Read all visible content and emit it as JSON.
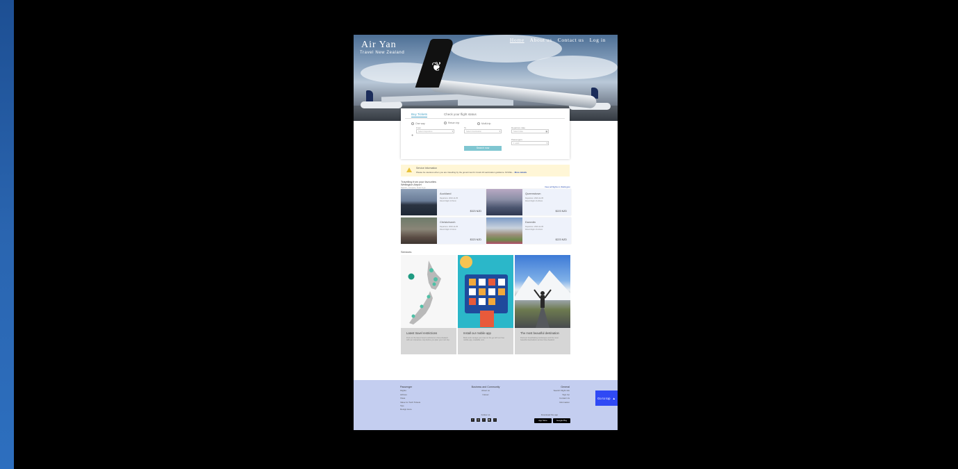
{
  "site": {
    "brand": "Air Yan",
    "tagline": "Travel New Zealand"
  },
  "nav": [
    "Home",
    "About us",
    "Contact us",
    "Log in"
  ],
  "booking": {
    "tabs": [
      "Buy Tickets",
      "Check your flight status"
    ],
    "trip_types": [
      "One way",
      "Return trip",
      "Multi-trip"
    ],
    "from_label": "From",
    "from_placeholder": "Select departure",
    "to_label": "To",
    "to_placeholder": "Select destination",
    "departure_label": "Departure date",
    "departure_placeholder": "Select date",
    "passengers_label": "Passengers",
    "passengers_value": "1 adult",
    "search_label": "Search now"
  },
  "announcement": {
    "title": "Service Information",
    "text": "Please be cautious when you are travelling by the government's Covid-19 vaccination guidance. NOVEL...",
    "link": "More details"
  },
  "destinations": {
    "heading": "Travelling from your favourites",
    "airport": "Wellington Airport",
    "sub": "Search, compare, book & go",
    "link": "View all flights in Wellington",
    "cards": [
      {
        "name": "Auckland",
        "meta1": "Departure: 2023-11-05",
        "meta2": "Direct Flight    1h 5min",
        "price": "$323 NZD"
      },
      {
        "name": "Queenstown",
        "meta1": "Departure: 2023-11-05",
        "meta2": "Direct Flight    1h 20min",
        "price": "$223 NZD"
      },
      {
        "name": "Christchurch",
        "meta1": "Departure: 2023-11-05",
        "meta2": "Direct Flight    1h 0min",
        "price": "$323 NZD"
      },
      {
        "name": "Dunedin",
        "meta1": "Departure: 2023-11-05",
        "meta2": "Direct Flight    1h 10min",
        "price": "$223 NZD"
      }
    ]
  },
  "services": {
    "title": "Services",
    "items": [
      {
        "title": "Latest travel restrictions",
        "desc": "Find out the latest travel restrictions in New Zealand with our interactive map before you plan your next trip."
      },
      {
        "title": "Install our mobile app",
        "desc": "Book and manage your trips on the go with our free mobile app, available now."
      },
      {
        "title": "The most beautiful destination",
        "desc": "Discover breathtaking landscapes and the most beautiful destinations across New Zealand."
      }
    ]
  },
  "footer": {
    "col1": {
      "heading": "Passenger",
      "items": [
        "Flights",
        "Airlines",
        "Visas",
        "Value for Tech Tickets",
        "Tips",
        "Design Here"
      ]
    },
    "col2": {
      "heading": "Business and Community",
      "items": [
        "About us",
        "Career"
      ]
    },
    "col3": {
      "heading": "General",
      "items": [
        "Search Flight info",
        "Sign Up",
        "Contact Us",
        "Information"
      ]
    },
    "follow": "Follow us",
    "download": "Download the app",
    "app_store": "App Store",
    "google_play": "Google Play"
  },
  "go_top": "Go to top"
}
